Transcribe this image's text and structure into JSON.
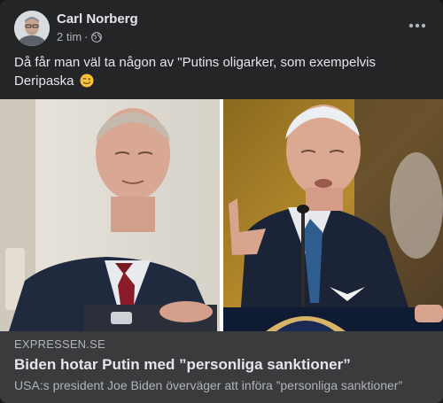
{
  "post": {
    "author": "Carl Norberg",
    "time": "2 tim",
    "separator": "·",
    "privacy_icon": "globe-icon",
    "menu_icon": "more-horizontal-icon",
    "text": "Då får man väl ta någon av \"Putins oligarker, som exempelvis Deripaska",
    "emoji": "winking-face-emoji"
  },
  "link_preview": {
    "domain": "EXPRESSEN.SE",
    "title": "Biden hotar Putin med ”personliga sanktioner”",
    "description": "USA:s president Joe Biden överväger att införa ”personliga sanktioner”"
  },
  "colors": {
    "card_bg": "#242526",
    "preview_bg": "#3a3b3c",
    "primary_text": "#e4e6eb",
    "secondary_text": "#b0b3b8"
  }
}
